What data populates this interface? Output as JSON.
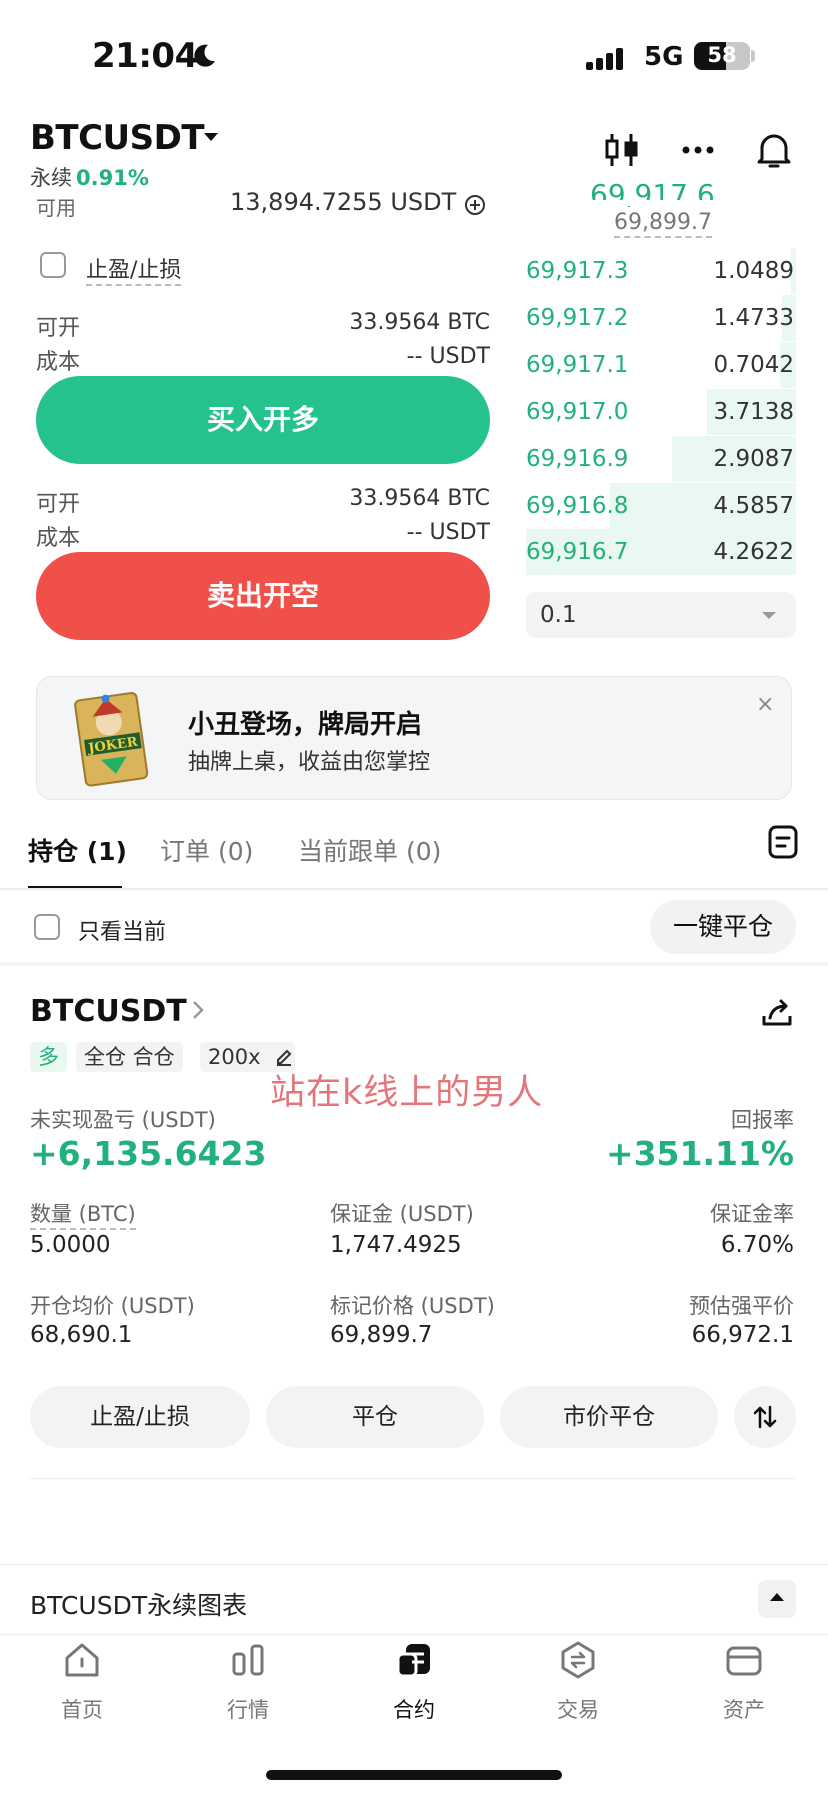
{
  "status_bar": {
    "time": "21:04",
    "network": "5G",
    "battery": "58"
  },
  "header": {
    "symbol": "BTCUSDT",
    "contract_type": "永续",
    "change": "0.91%"
  },
  "order_form": {
    "available_label": "可用",
    "available_value": "13,894.7255 USDT",
    "tpsl_label": "止盈/止损",
    "buy": {
      "openable_label": "可开",
      "openable_value": "33.9564 BTC",
      "cost_label": "成本",
      "cost_value": "-- USDT",
      "button": "买入开多"
    },
    "sell": {
      "openable_label": "可开",
      "openable_value": "33.9564 BTC",
      "cost_label": "成本",
      "cost_value": "-- USDT",
      "button": "卖出开空"
    }
  },
  "orderbook": {
    "last_price_partial": "69,917.6",
    "mark_price": "69,899.7",
    "bids": [
      {
        "price": "69,917.3",
        "qty": "1.0489",
        "depth": 0.02
      },
      {
        "price": "69,917.2",
        "qty": "1.4733",
        "depth": 0.05
      },
      {
        "price": "69,917.1",
        "qty": "0.7042",
        "depth": 0.06
      },
      {
        "price": "69,917.0",
        "qty": "3.7138",
        "depth": 0.33
      },
      {
        "price": "69,916.9",
        "qty": "2.9087",
        "depth": 0.46
      },
      {
        "price": "69,916.8",
        "qty": "4.5857",
        "depth": 0.69
      },
      {
        "price": "69,916.7",
        "qty": "4.2622",
        "depth": 1.0
      }
    ],
    "precision": "0.1"
  },
  "banner": {
    "title": "小丑登场，牌局开启",
    "subtitle": "抽牌上桌，收益由您掌控",
    "image_text": "JOKER",
    "close": "×"
  },
  "tabs": [
    {
      "label": "持仓 (1)",
      "active": true
    },
    {
      "label": "订单 (0)",
      "active": false
    },
    {
      "label": "当前跟单 (0)",
      "active": false
    }
  ],
  "filter": {
    "only_current": "只看当前",
    "close_all": "一键平仓"
  },
  "position": {
    "symbol": "BTCUSDT",
    "side": "多",
    "margin_mode": "全仓 合仓",
    "leverage": "200x",
    "watermark": "站在k线上的男人",
    "pnl_label": "未实现盈亏 (USDT)",
    "pnl_value": "+6,135.6423",
    "roe_label": "回报率",
    "roe_value": "+351.11%",
    "fields": [
      {
        "label": "数量 (BTC)",
        "value": "5.0000"
      },
      {
        "label": "保证金 (USDT)",
        "value": "1,747.4925"
      },
      {
        "label": "保证金率",
        "value": "6.70%"
      },
      {
        "label": "开仓均价 (USDT)",
        "value": "68,690.1"
      },
      {
        "label": "标记价格 (USDT)",
        "value": "69,899.7"
      },
      {
        "label": "预估强平价",
        "value": "66,972.1"
      }
    ],
    "actions": {
      "tpsl": "止盈/止损",
      "close": "平仓",
      "market_close": "市价平仓"
    }
  },
  "chart_section": {
    "title": "BTCUSDT永续图表"
  },
  "bottom_nav": [
    {
      "label": "首页",
      "icon": "home-icon",
      "active": false
    },
    {
      "label": "行情",
      "icon": "market-icon",
      "active": false
    },
    {
      "label": "合约",
      "icon": "futures-icon",
      "active": true
    },
    {
      "label": "交易",
      "icon": "trade-icon",
      "active": false
    },
    {
      "label": "资产",
      "icon": "wallet-icon",
      "active": false
    }
  ],
  "colors": {
    "green": "#25c28b",
    "red": "#f0504a",
    "watermark": "#e4767b"
  }
}
